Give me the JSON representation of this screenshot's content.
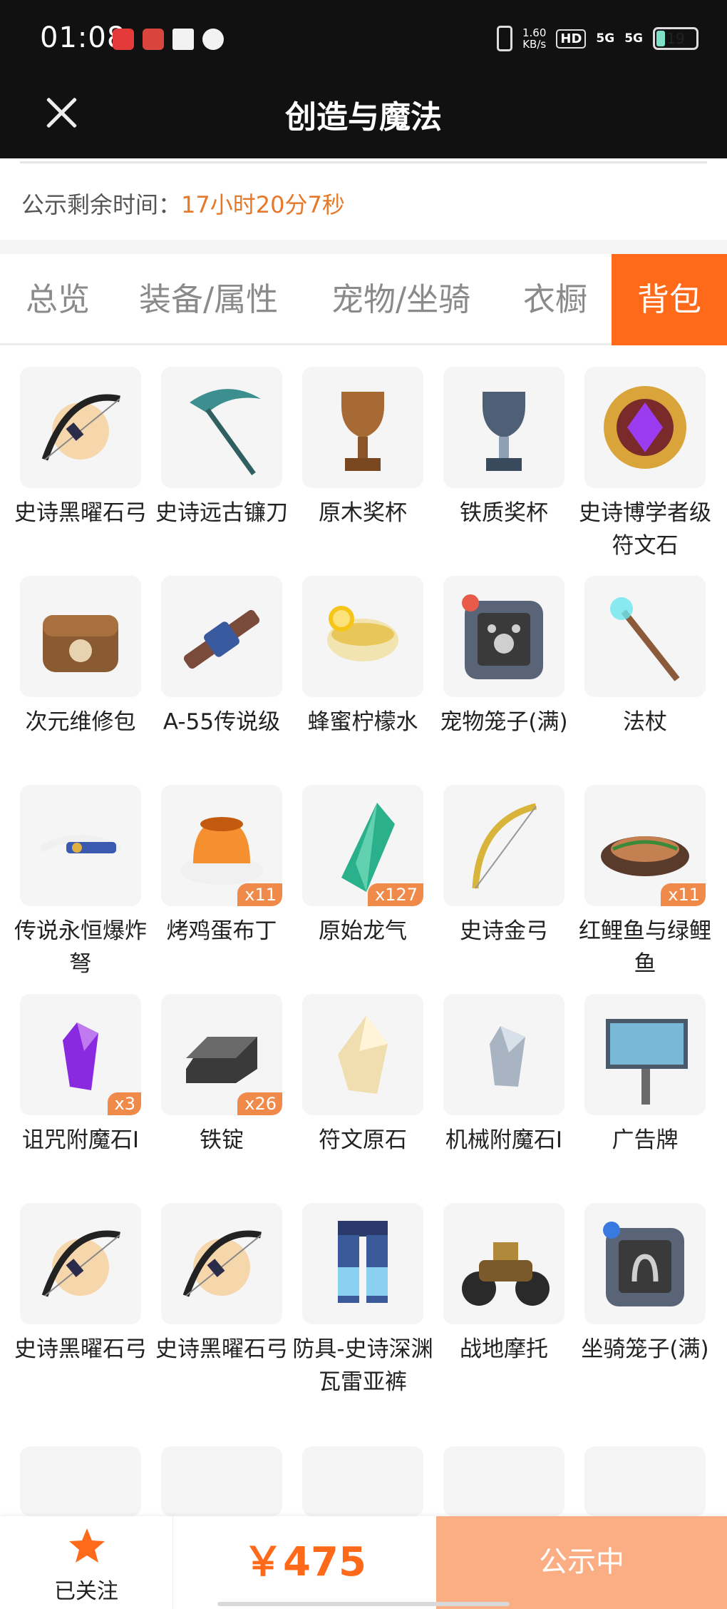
{
  "status_bar": {
    "time": "01:08",
    "net_speed": "1.60",
    "net_unit": "KB/s",
    "hd": "HD",
    "sig1": "5G",
    "sig2": "5G",
    "battery": "19"
  },
  "header": {
    "title": "创造与魔法"
  },
  "notice": {
    "label": "公示剩余时间：",
    "remaining": "17小时20分7秒"
  },
  "tabs": [
    {
      "label": "总览",
      "active": false
    },
    {
      "label": "装备/属性",
      "active": false
    },
    {
      "label": "宠物/坐骑",
      "active": false
    },
    {
      "label": "衣橱",
      "active": false
    },
    {
      "label": "背包",
      "active": true
    }
  ],
  "items": [
    {
      "name": "史诗黑曜石弓",
      "icon": "bow-icon"
    },
    {
      "name": "史诗远古镰刀",
      "icon": "scythe-icon"
    },
    {
      "name": "原木奖杯",
      "icon": "wood-trophy-icon"
    },
    {
      "name": "铁质奖杯",
      "icon": "iron-trophy-icon"
    },
    {
      "name": "史诗博学者级符文石",
      "icon": "rune-stone-icon"
    },
    {
      "name": "次元维修包",
      "icon": "repair-bag-icon"
    },
    {
      "name": "A-55传说级",
      "icon": "rifle-icon"
    },
    {
      "name": "蜂蜜柠檬水",
      "icon": "tea-cup-icon"
    },
    {
      "name": "宠物笼子(满)",
      "icon": "pet-cage-icon"
    },
    {
      "name": "法杖",
      "icon": "staff-icon"
    },
    {
      "name": "传说永恒爆炸弩",
      "icon": "crossbow-icon"
    },
    {
      "name": "烤鸡蛋布丁",
      "icon": "pudding-icon",
      "count": "x11"
    },
    {
      "name": "原始龙气",
      "icon": "dragon-crystal-icon",
      "count": "x127"
    },
    {
      "name": "史诗金弓",
      "icon": "gold-bow-icon"
    },
    {
      "name": "红鲤鱼与绿鲤鱼",
      "icon": "fish-dish-icon",
      "count": "x11"
    },
    {
      "name": "诅咒附魔石Ⅰ",
      "icon": "purple-crystal-icon",
      "count": "x3"
    },
    {
      "name": "铁锭",
      "icon": "iron-ingot-icon",
      "count": "x26"
    },
    {
      "name": "符文原石",
      "icon": "rune-ore-icon"
    },
    {
      "name": "机械附魔石Ⅰ",
      "icon": "gray-crystal-icon"
    },
    {
      "name": "广告牌",
      "icon": "billboard-icon"
    },
    {
      "name": "史诗黑曜石弓",
      "icon": "bow-icon"
    },
    {
      "name": "史诗黑曜石弓",
      "icon": "bow-icon"
    },
    {
      "name": "防具-史诗深渊瓦雷亚裤",
      "icon": "armor-pants-icon"
    },
    {
      "name": "战地摩托",
      "icon": "motorbike-icon"
    },
    {
      "name": "坐骑笼子(满)",
      "icon": "mount-cage-icon"
    }
  ],
  "bottom": {
    "follow_label": "已关注",
    "price": "￥475",
    "status_label": "公示中"
  },
  "colors": {
    "accent": "#ff6a1a",
    "timer": "#e6782a",
    "count_badge": "#f08a4a",
    "status_btn": "#fbad84"
  }
}
